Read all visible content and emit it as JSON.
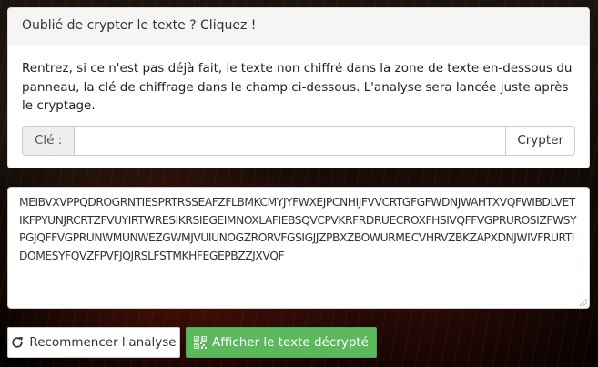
{
  "panel": {
    "heading": "Oublié de crypter le texte ? Cliquez !",
    "instructions": "Rentrez, si ce n'est pas déjà fait, le texte non chiffré dans la zone de texte en-dessous du panneau, la clé de chiffrage dans le champ ci-dessous. L'analyse sera lancée juste après le cryptage.",
    "key_label": "Clé :",
    "key_value": "",
    "key_placeholder": "",
    "crypt_button": "Crypter"
  },
  "ciphertext": "MEIBVXVPPQDROGRNTIESPRTRSSEAFZFLBMKCMYJYFWXEJPCNHIJFVVCRTGFGFWDNJWAHTXVQFWIBDLVETIKFPYUNJRCRTZFVUYIRTWRESIKRSIEGEIMNOXLAFIEBSQVCPVKRFRDRUECROXFHSIVQFFVGPRUROSIZFWSYPGJQFFVGPRUNWMUNWEZGWMJVUIUNOGZRORVFGSIGJJZPBXZBOWURMECVHRVZBKZAPXDNJWIVFRURTIDOMESYFQVZFPVFJQJRSLFSTMKHFEGEPBZZJXVQF",
  "actions": {
    "restart_label": "Recommencer l'analyse",
    "show_label": "Afficher le texte décrypté",
    "restart_icon": "refresh-icon",
    "show_icon": "qrcode-icon"
  },
  "colors": {
    "success": "#5cb85c",
    "panel_heading_bg": "#f5f5f5"
  }
}
